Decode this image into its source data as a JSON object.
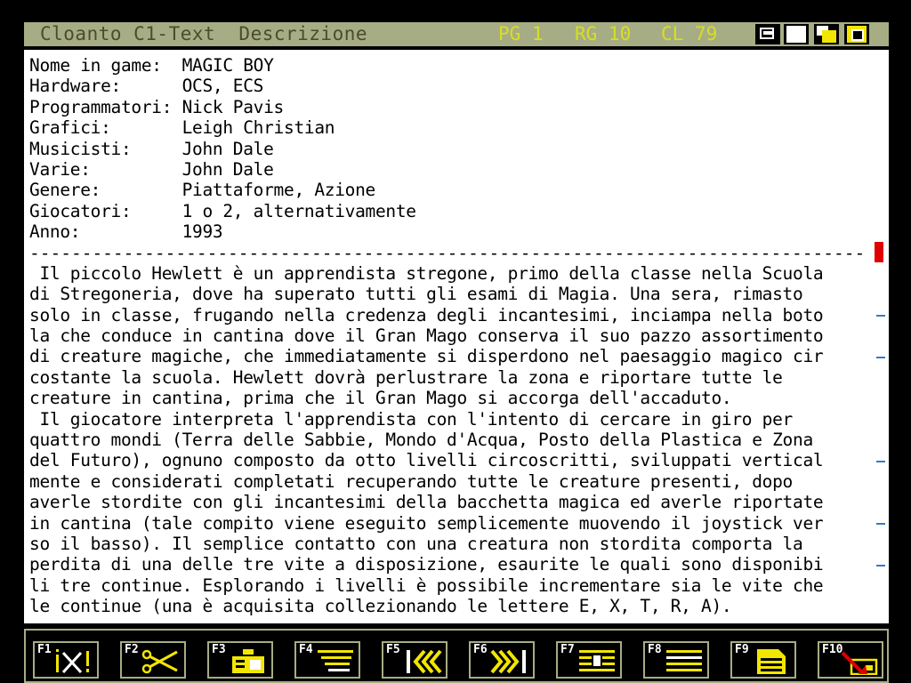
{
  "titlebar": {
    "title": "Cloanto C1-Text  Descrizione",
    "page": "PG 1",
    "row": "RG 10",
    "col": "CL 79"
  },
  "document": {
    "lines": [
      "Nome in game:  MAGIC BOY",
      "Hardware:      OCS, ECS",
      "Programmatori: Nick Pavis",
      "Grafici:       Leigh Christian",
      "Musicisti:     John Dale",
      "Varie:         John Dale",
      "Genere:        Piattaforme, Azione",
      "Giocatori:     1 o 2, alternativamente",
      "Anno:          1993",
      "--------------------------------------------------------------------------------",
      " Il piccolo Hewlett è un apprendista stregone, primo della classe nella Scuola",
      "di Stregoneria, dove ha superato tutti gli esami di Magia. Una sera, rimasto",
      "solo in classe, frugando nella credenza degli incantesimi, inciampa nella boto",
      "la che conduce in cantina dove il Gran Mago conserva il suo pazzo assortimento",
      "di creature magiche, che immediatamente si disperdono nel paesaggio magico cir",
      "costante la scuola. Hewlett dovrà perlustrare la zona e riportare tutte le",
      "creature in cantina, prima che il Gran Mago si accorga dell'accaduto.",
      " Il giocatore interpreta l'apprendista con l'intento di cercare in giro per",
      "quattro mondi (Terra delle Sabbie, Mondo d'Acqua, Posto della Plastica e Zona",
      "del Futuro), ognuno composto da otto livelli circoscritti, sviluppati vertical",
      "mente e considerati completati recuperando tutte le creature presenti, dopo",
      "averle stordite con gli incantesimi della bacchetta magica ed averle riportate",
      "in cantina (tale compito viene eseguito semplicemente muovendo il joystick ver",
      "so il basso). Il semplice contatto con una creatura non stordita comporta la",
      "perdita di una delle tre vite a disposizione, esaurite le quali sono disponibi",
      "li tre continue. Esplorando i livelli è possibile incrementare sia le vite che",
      "le continue (una è acquisita collezionando le lettere E, X, T, R, A)."
    ]
  },
  "fkeys": [
    {
      "label": "F1",
      "icon": "clear-icon"
    },
    {
      "label": "F2",
      "icon": "cut-icon"
    },
    {
      "label": "F3",
      "icon": "paste-icon"
    },
    {
      "label": "F4",
      "icon": "format-icon"
    },
    {
      "label": "F5",
      "icon": "first-page-icon"
    },
    {
      "label": "F6",
      "icon": "last-page-icon"
    },
    {
      "label": "F7",
      "icon": "insert-icon"
    },
    {
      "label": "F8",
      "icon": "align-icon"
    },
    {
      "label": "F9",
      "icon": "document-icon"
    },
    {
      "label": "F10",
      "icon": "quit-icon"
    }
  ],
  "colors": {
    "titlebar_bg": "#a6ad84",
    "title_text": "#4c4c2a",
    "status_text": "#d8de22",
    "icon_yellow": "#f2e600",
    "cursor": "#e00000",
    "wrap_marker": "#3a78c8"
  }
}
